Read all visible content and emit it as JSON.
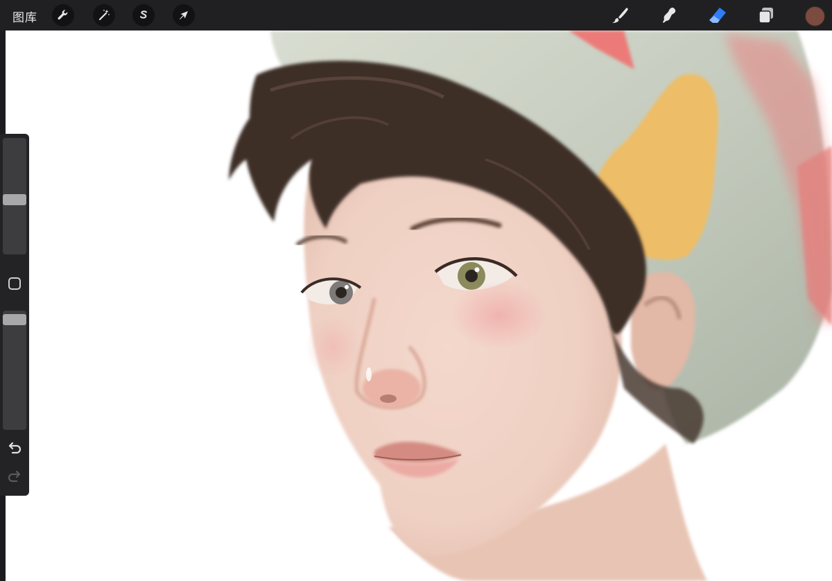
{
  "app": {
    "gallery_label": "图库"
  },
  "toolbar": {
    "left_tools": [
      {
        "name": "actions",
        "icon": "wrench-icon"
      },
      {
        "name": "adjustments",
        "icon": "magic-wand-icon"
      },
      {
        "name": "selection",
        "icon": "selection-s-icon"
      },
      {
        "name": "transform",
        "icon": "arrow-cursor-icon"
      }
    ],
    "right_tools": [
      {
        "name": "brush",
        "icon": "brush-icon",
        "active": false
      },
      {
        "name": "smudge",
        "icon": "smudge-icon",
        "active": false
      },
      {
        "name": "eraser",
        "icon": "eraser-icon",
        "active": true
      },
      {
        "name": "layers",
        "icon": "layers-icon",
        "active": false
      }
    ],
    "current_color": "#7a4b3e",
    "active_color": "#2f7cf6"
  },
  "sidebar": {
    "brush_size_level": 0.47,
    "opacity_level": 0.97,
    "modifier_icon": "square-modifier-icon",
    "undo_icon": "undo-icon",
    "redo_icon": "redo-icon"
  }
}
